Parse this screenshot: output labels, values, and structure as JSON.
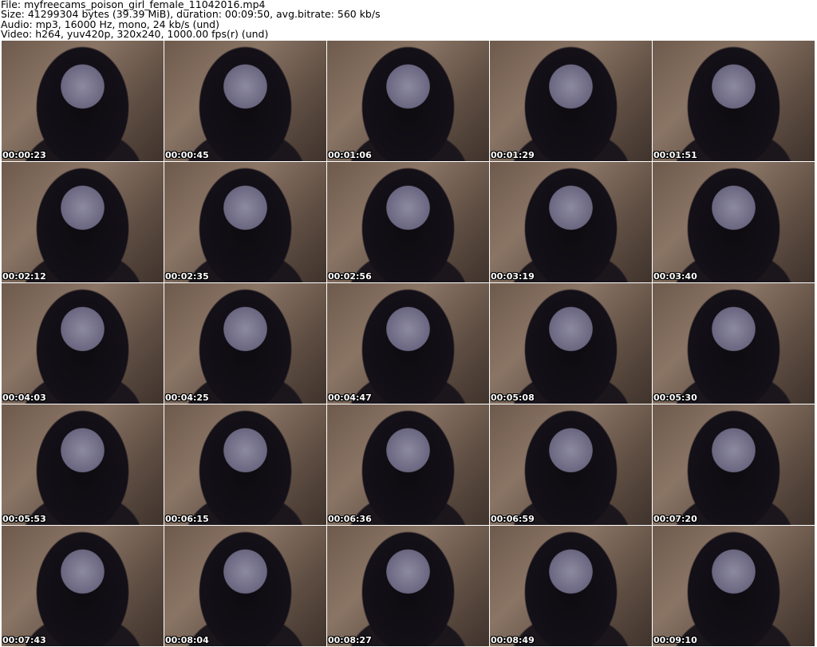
{
  "info": {
    "file": "File: myfreecams_poison_girl_female_11042016.mp4",
    "size": "Size: 41299304 bytes (39.39 MiB), duration: 00:09:50, avg.bitrate: 560 kb/s",
    "audio": "Audio: mp3, 16000 Hz, mono, 24 kb/s (und)",
    "video": "Video: h264, yuv420p, 320x240, 1000.00 fps(r) (und)"
  },
  "thumbnails": [
    {
      "time": "00:00:23"
    },
    {
      "time": "00:00:45"
    },
    {
      "time": "00:01:06"
    },
    {
      "time": "00:01:29"
    },
    {
      "time": "00:01:51"
    },
    {
      "time": "00:02:12"
    },
    {
      "time": "00:02:35"
    },
    {
      "time": "00:02:56"
    },
    {
      "time": "00:03:19"
    },
    {
      "time": "00:03:40"
    },
    {
      "time": "00:04:03"
    },
    {
      "time": "00:04:25"
    },
    {
      "time": "00:04:47"
    },
    {
      "time": "00:05:08"
    },
    {
      "time": "00:05:30"
    },
    {
      "time": "00:05:53"
    },
    {
      "time": "00:06:15"
    },
    {
      "time": "00:06:36"
    },
    {
      "time": "00:06:59"
    },
    {
      "time": "00:07:20"
    },
    {
      "time": "00:07:43"
    },
    {
      "time": "00:08:04"
    },
    {
      "time": "00:08:27"
    },
    {
      "time": "00:08:49"
    },
    {
      "time": "00:09:10"
    }
  ]
}
